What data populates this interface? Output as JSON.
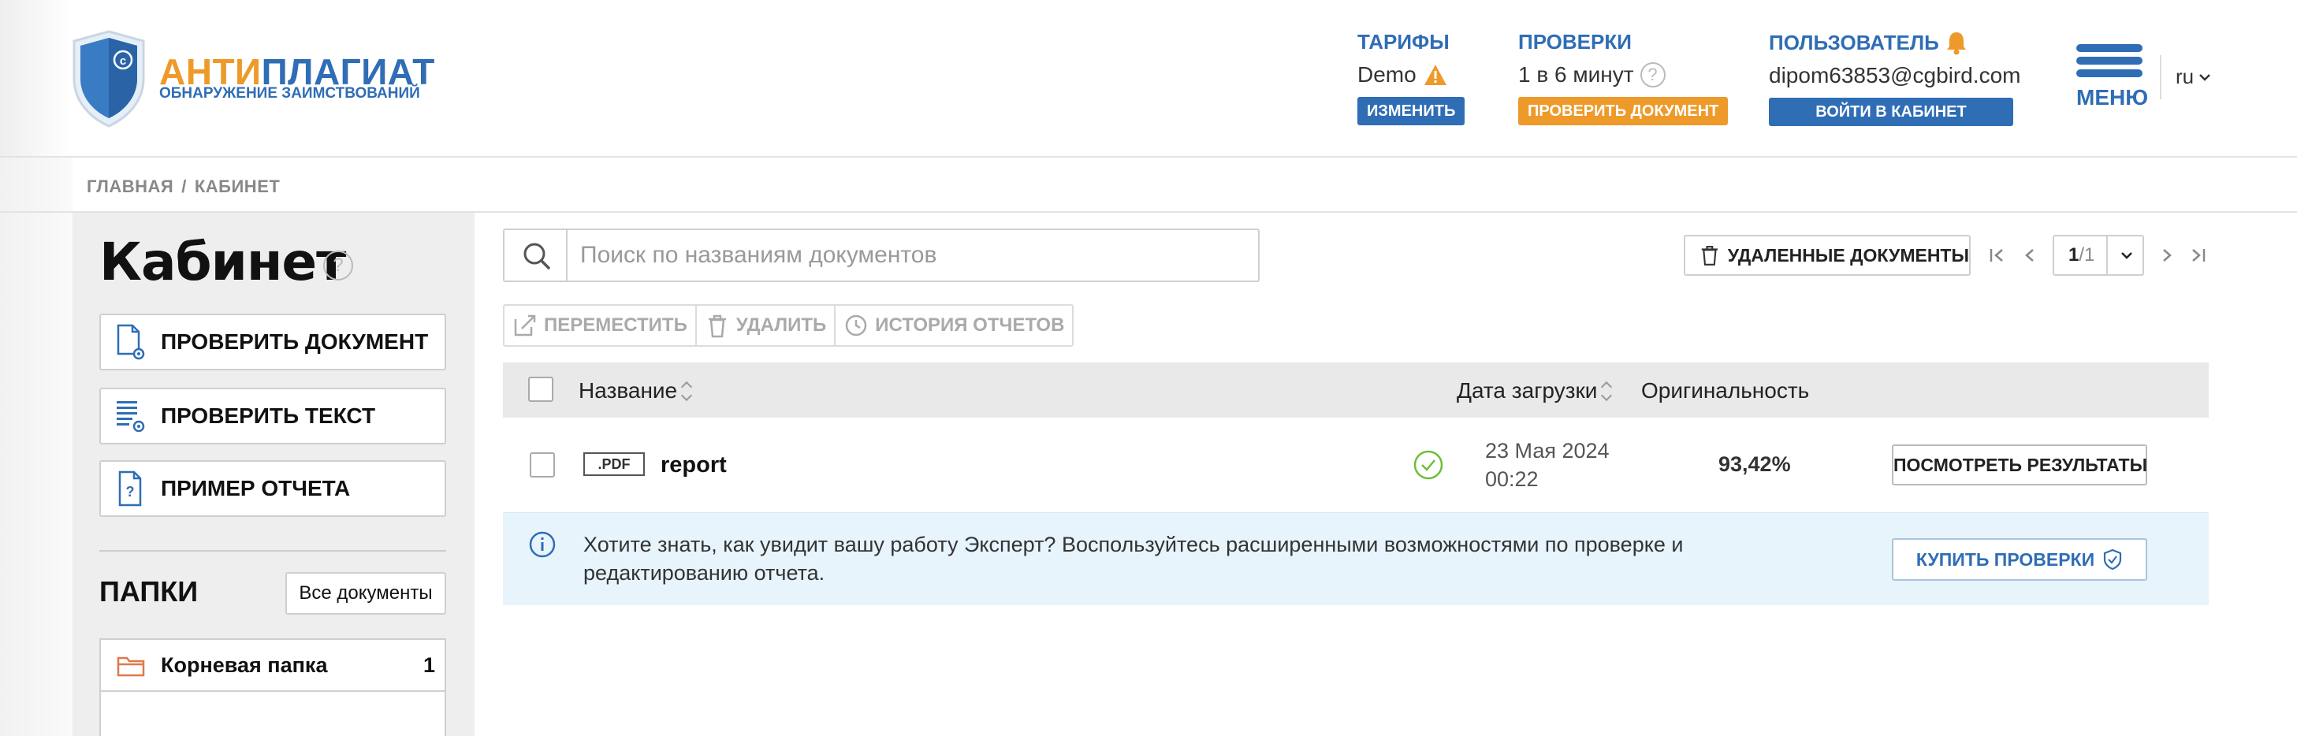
{
  "brand": {
    "name_part1": "АНТИ",
    "name_part2": "ПЛАГИАТ",
    "subtitle": "ОБНАРУЖЕНИЕ ЗАИМСТВОВАНИЙ",
    "accent_orange": "#ee9a2a",
    "accent_blue": "#2f6db5"
  },
  "header": {
    "tariffs": {
      "title": "ТАРИФЫ",
      "value": "Demo",
      "button": "ИЗМЕНИТЬ",
      "icon": "warning-icon"
    },
    "checks": {
      "title": "ПРОВЕРКИ",
      "value": "1 в 6 минут",
      "button": "ПРОВЕРИТЬ ДОКУМЕНТ",
      "icon": "help-icon"
    },
    "user": {
      "title": "ПОЛЬЗОВАТЕЛЬ",
      "email": "dipom63853@cgbird.com",
      "button": "ВОЙТИ В КАБИНЕТ",
      "icon": "bell-icon"
    },
    "menu_label": "МЕНЮ",
    "language": "ru"
  },
  "breadcrumb": {
    "home": "ГЛАВНАЯ",
    "separator": "/",
    "current": "КАБИНЕТ"
  },
  "sidebar": {
    "title": "Кабинет",
    "help_glyph": "?",
    "actions": [
      {
        "label": "ПРОВЕРИТЬ ДОКУМЕНТ",
        "icon": "document-check-icon"
      },
      {
        "label": "ПРОВЕРИТЬ ТЕКСТ",
        "icon": "text-check-icon"
      },
      {
        "label": "ПРИМЕР ОТЧЕТА",
        "icon": "report-example-icon"
      }
    ],
    "folders_title": "ПАПКИ",
    "all_docs_label": "Все документы",
    "folders": [
      {
        "name": "Корневая папка",
        "count": "1",
        "icon": "folder-icon"
      }
    ]
  },
  "main": {
    "search": {
      "placeholder": "Поиск по названиям документов",
      "value": ""
    },
    "deleted_docs_label": "УДАЛЕННЫЕ ДОКУМЕНТЫ",
    "pagination": {
      "current": "1",
      "separator": "/",
      "total": "1"
    },
    "toolbar": {
      "move": "ПЕРЕМЕСТИТЬ",
      "delete": "УДАЛИТЬ",
      "history": "ИСТОРИЯ ОТЧЕТОВ"
    },
    "columns": {
      "name": "Название",
      "date": "Дата загрузки",
      "originality": "Оригинальность"
    },
    "rows": [
      {
        "type": ".PDF",
        "name": "report",
        "status_icon": "check-circle-icon",
        "date_line1": "23 Мая 2024",
        "date_line2": "00:22",
        "originality": "93,42%",
        "action": "ПОСМОТРЕТЬ РЕЗУЛЬТАТЫ"
      }
    ],
    "info_banner": {
      "text": "Хотите знать, как увидит вашу работу Эксперт? Воспользуйтесь расширенными возможностями по проверке и редактированию отчета.",
      "button": "КУПИТЬ ПРОВЕРКИ"
    }
  }
}
